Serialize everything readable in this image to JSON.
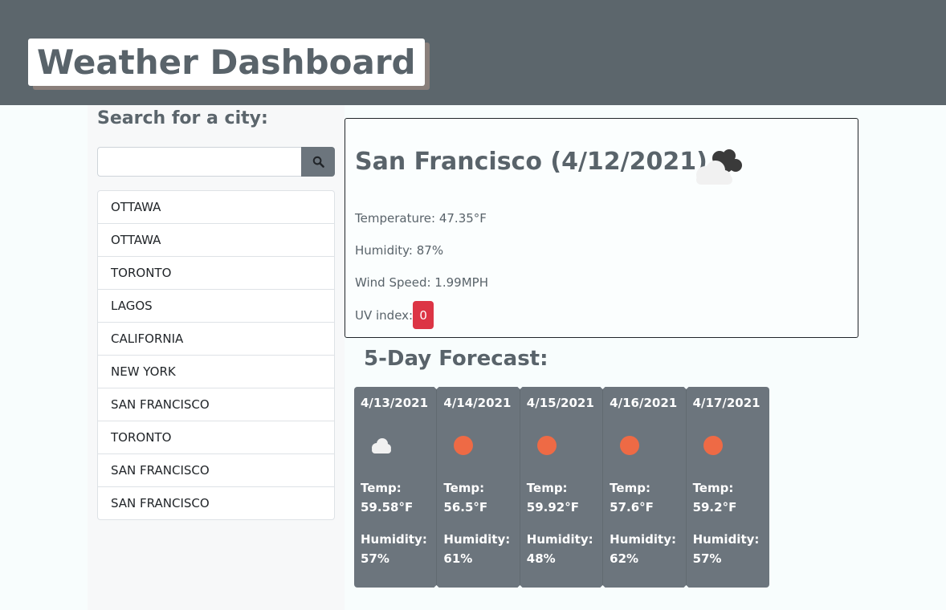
{
  "header": {
    "title": "Weather Dashboard"
  },
  "sidebar": {
    "search_label": "Search for a city:",
    "search_value": "",
    "search_icon": "search-icon",
    "history": [
      "OTTAWA",
      "OTTAWA",
      "TORONTO",
      "LAGOS",
      "CALIFORNIA",
      "NEW YORK",
      "SAN FRANCISCO",
      "TORONTO",
      "SAN FRANCISCO",
      "SAN FRANCISCO"
    ]
  },
  "current": {
    "heading": "San Francisco (4/12/2021)",
    "icon": "cloudy-icon",
    "temperature": "Temperature: 47.35°F",
    "humidity": "Humidity: 87%",
    "wind": "Wind Speed: 1.99MPH",
    "uv_label": "UV index:",
    "uv_value": "0",
    "uv_color": "#dc3545"
  },
  "forecast": {
    "title": "5-Day Forecast:",
    "days": [
      {
        "date": "4/13/2021",
        "icon": "cloud-icon",
        "temp_label": "Temp:",
        "temp": "59.58°F",
        "humidity_label": "Humidity:",
        "humidity": "57%"
      },
      {
        "date": "4/14/2021",
        "icon": "sun-icon",
        "temp_label": "Temp:",
        "temp": "56.5°F",
        "humidity_label": "Humidity:",
        "humidity": "61%"
      },
      {
        "date": "4/15/2021",
        "icon": "sun-icon",
        "temp_label": "Temp:",
        "temp": "59.92°F",
        "humidity_label": "Humidity:",
        "humidity": "48%"
      },
      {
        "date": "4/16/2021",
        "icon": "sun-icon",
        "temp_label": "Temp:",
        "temp": "57.6°F",
        "humidity_label": "Humidity:",
        "humidity": "62%"
      },
      {
        "date": "4/17/2021",
        "icon": "sun-icon",
        "temp_label": "Temp:",
        "temp": "59.2°F",
        "humidity_label": "Humidity:",
        "humidity": "57%"
      }
    ]
  },
  "colors": {
    "header_bg": "#5c666c",
    "card_bg": "#6c757d",
    "sun": "#ee6a45",
    "uv_badge": "#dc3545"
  }
}
